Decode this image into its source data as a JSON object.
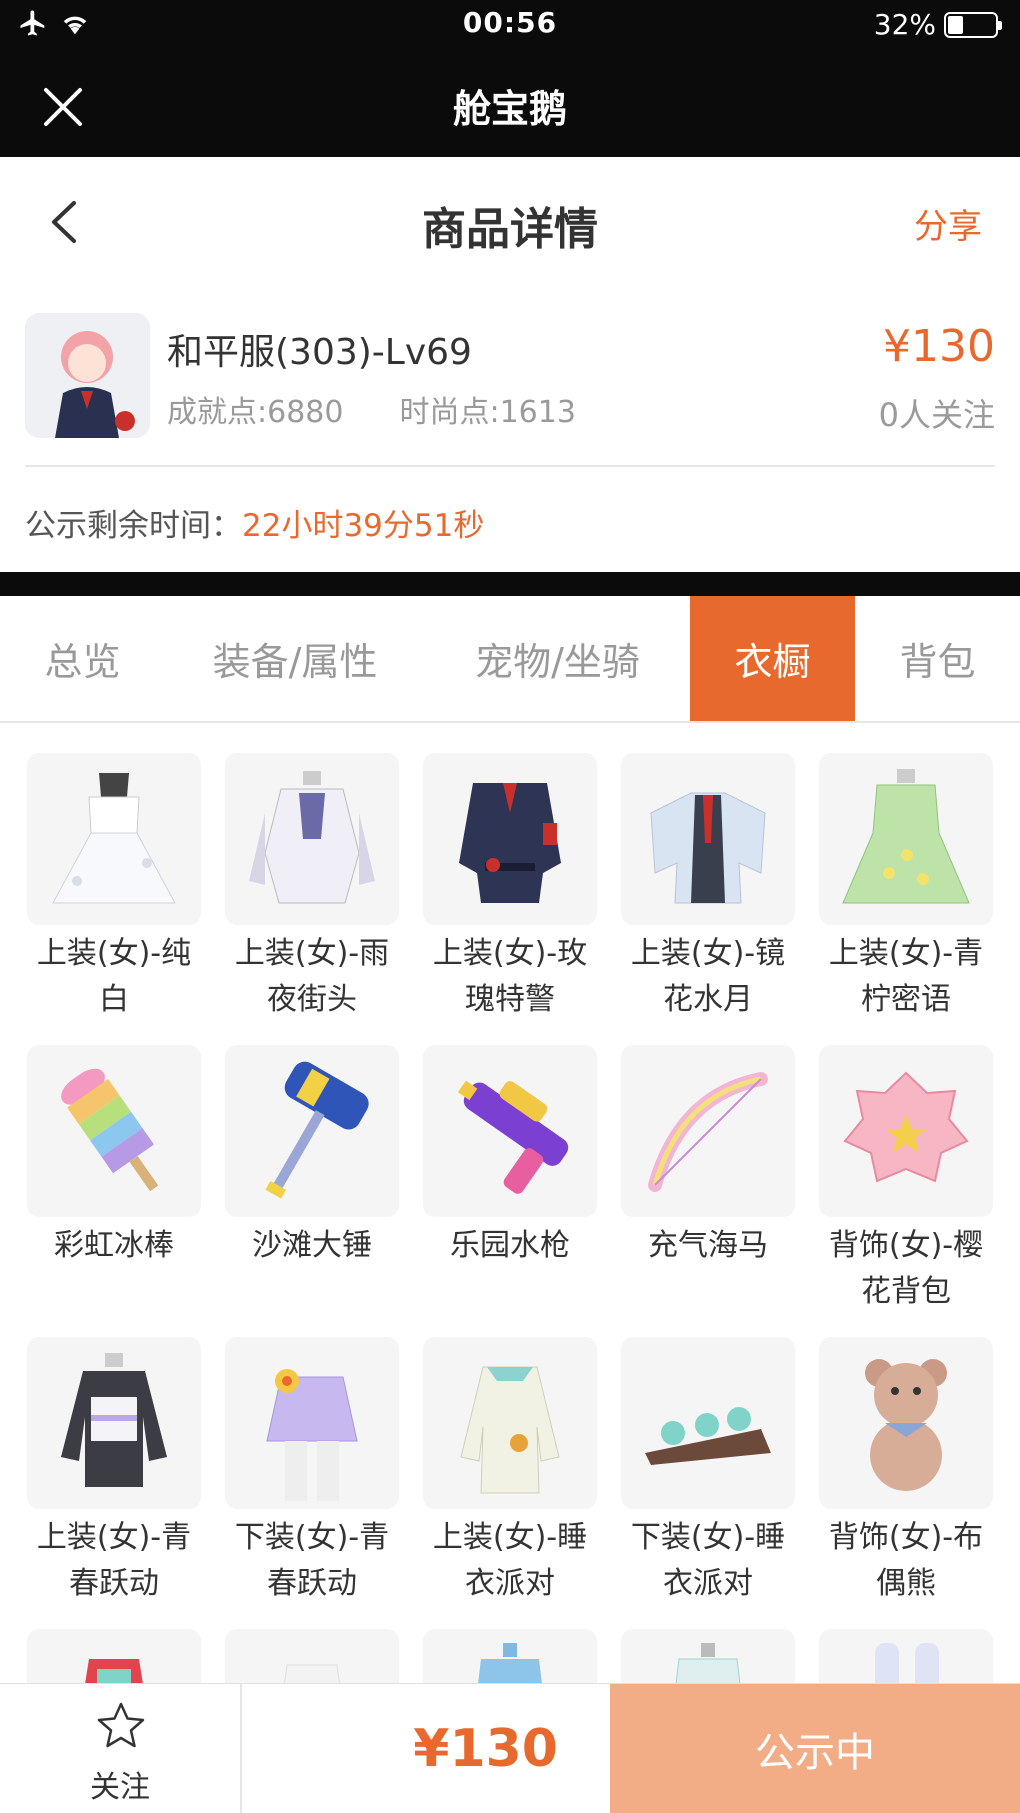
{
  "status_bar": {
    "time": "00:56",
    "battery_percent": "32%",
    "battery_level": 0.32
  },
  "app_bar": {
    "title": "舱宝鹅"
  },
  "page_header": {
    "title": "商品详情",
    "share_label": "分享"
  },
  "product": {
    "name": "和平服(303)-Lv69",
    "achievement": "成就点:6880",
    "fashion": "时尚点:1613",
    "price": "¥130",
    "followers": "0人关注",
    "countdown_label": "公示剩余时间：",
    "countdown_value": "22小时39分51秒"
  },
  "tabs": [
    {
      "label": "总览",
      "active": false
    },
    {
      "label": "装备/属性",
      "active": false
    },
    {
      "label": "宠物/坐骑",
      "active": false
    },
    {
      "label": "衣橱",
      "active": true
    },
    {
      "label": "背包",
      "active": false
    }
  ],
  "wardrobe_items": [
    {
      "line1": "上装(女)-纯",
      "line2": "白",
      "icon": "white-dress-icon"
    },
    {
      "line1": "上装(女)-雨",
      "line2": "夜街头",
      "icon": "rainy-street-top-icon"
    },
    {
      "line1": "上装(女)-玫",
      "line2": "瑰特警",
      "icon": "rose-police-uniform-icon"
    },
    {
      "line1": "上装(女)-镜",
      "line2": "花水月",
      "icon": "mirror-flower-dress-icon"
    },
    {
      "line1": "上装(女)-青",
      "line2": "柠密语",
      "icon": "green-lemon-dress-icon"
    },
    {
      "line1": "彩虹冰棒",
      "line2": "",
      "icon": "rainbow-popsicle-icon"
    },
    {
      "line1": "沙滩大锤",
      "line2": "",
      "icon": "beach-hammer-icon"
    },
    {
      "line1": "乐园水枪",
      "line2": "",
      "icon": "water-gun-icon"
    },
    {
      "line1": "充气海马",
      "line2": "",
      "icon": "inflatable-bow-icon"
    },
    {
      "line1": "背饰(女)-樱",
      "line2": "花背包",
      "icon": "sakura-backpack-icon"
    },
    {
      "line1": "上装(女)-青",
      "line2": "春跃动",
      "icon": "youth-top-icon"
    },
    {
      "line1": "下装(女)-青",
      "line2": "春跃动",
      "icon": "youth-skirt-icon"
    },
    {
      "line1": "上装(女)-睡",
      "line2": "衣派对",
      "icon": "pajama-top-icon"
    },
    {
      "line1": "下装(女)-睡",
      "line2": "衣派对",
      "icon": "pajama-bottom-icon"
    },
    {
      "line1": "背饰(女)-布",
      "line2": "偶熊",
      "icon": "teddy-bear-icon"
    },
    {
      "line1": "",
      "line2": "",
      "icon": "partial-item-icon"
    },
    {
      "line1": "",
      "line2": "",
      "icon": "partial-item-icon"
    },
    {
      "line1": "",
      "line2": "",
      "icon": "partial-item-icon"
    },
    {
      "line1": "",
      "line2": "",
      "icon": "partial-item-icon"
    },
    {
      "line1": "",
      "line2": "",
      "icon": "partial-item-icon"
    }
  ],
  "bottom_bar": {
    "follow_label": "关注",
    "price": "¥130",
    "status_label": "公示中"
  },
  "colors": {
    "accent": "#e8692d",
    "accent_light": "#f2ad86",
    "bar": "#0b0b0b"
  }
}
